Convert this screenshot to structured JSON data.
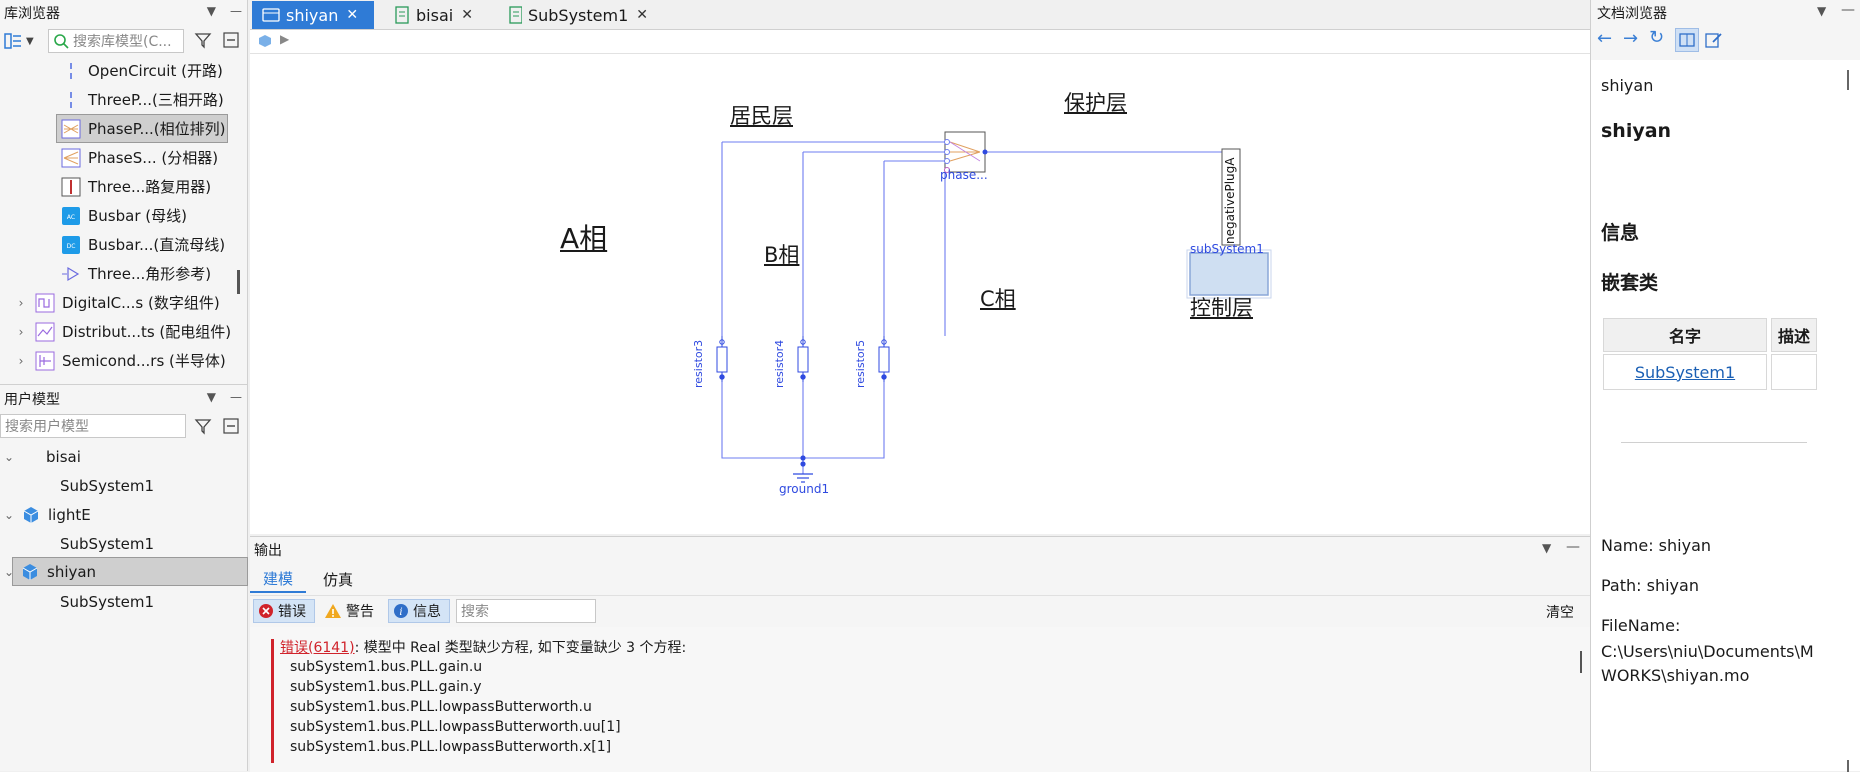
{
  "left": {
    "lib_title": "库浏览器",
    "lib_search_placeholder": "搜索库模型(C...",
    "lib_items": [
      {
        "label": "OpenCircuit (开路)",
        "icon": "open-circuit-icon"
      },
      {
        "label": "ThreeP...(三相开路)",
        "icon": "three-phase-open-icon"
      },
      {
        "label": "PhaseP...(相位排列)",
        "icon": "phase-permute-icon",
        "selected": true
      },
      {
        "label": "PhaseS... (分相器)",
        "icon": "phase-splitter-icon"
      },
      {
        "label": "Three...路复用器)",
        "icon": "multiplexer-icon"
      },
      {
        "label": "Busbar (母线)",
        "icon": "busbar-ac-icon"
      },
      {
        "label": "Busbar...(直流母线)",
        "icon": "busbar-dc-icon"
      },
      {
        "label": "Three...角形参考)",
        "icon": "delta-reference-icon"
      }
    ],
    "lib_groups": [
      {
        "label": "DigitalC...s (数字组件)",
        "icon": "digital-icon"
      },
      {
        "label": "Distribut...ts (配电组件)",
        "icon": "distribution-icon"
      },
      {
        "label": "Semicond...rs (半导体)",
        "icon": "semiconductor-icon"
      }
    ],
    "user_title": "用户模型",
    "user_search_placeholder": "搜索用户模型",
    "user_tree": [
      {
        "label": "bisai",
        "child": "SubSystem1"
      },
      {
        "label": "lightE",
        "child": "SubSystem1"
      },
      {
        "label": "shiyan",
        "child": "SubSystem1",
        "selected": true
      }
    ]
  },
  "tabs": [
    {
      "label": "shiyan",
      "active": true
    },
    {
      "label": "bisai",
      "active": false
    },
    {
      "label": "SubSystem1",
      "active": false
    }
  ],
  "diagram": {
    "labels": {
      "a_phase": "A相",
      "b_phase": "B相",
      "c_phase": "C相",
      "resident_layer": "居民层",
      "protection_layer": "保护层",
      "control_layer": "控制层"
    },
    "components": {
      "phase": "phase...",
      "resistor3": "resistor3",
      "resistor4": "resistor4",
      "resistor5": "resistor5",
      "ground": "ground1",
      "subsystem": "subSystem1",
      "negplug": "negativePlugA"
    }
  },
  "output": {
    "title": "输出",
    "tabs": [
      "建模",
      "仿真"
    ],
    "filters": {
      "error": "错误",
      "warning": "警告",
      "info": "信息"
    },
    "search_placeholder": "搜索",
    "clear": "清空",
    "error_code": "错误(6141)",
    "error_msg": ": 模型中 Real 类型缺少方程, 如下变量缺少 3 个方程:",
    "lines": [
      "subSystem1.bus.PLL.gain.u",
      "subSystem1.bus.PLL.gain.y",
      "subSystem1.bus.PLL.lowpassButterworth.u",
      "subSystem1.bus.PLL.lowpassButterworth.uu[1]",
      "subSystem1.bus.PLL.lowpassButterworth.x[1]"
    ]
  },
  "right": {
    "title": "文档浏览器",
    "crumb": "shiyan",
    "heading": "shiyan",
    "info": "信息",
    "nested": "嵌套类",
    "table_headers": [
      "名字",
      "描述"
    ],
    "table_row": "SubSystem1",
    "name_line": "Name: shiyan",
    "path_line": "Path: shiyan",
    "file_label": "FileName:",
    "file_path": "C:\\Users\\niu\\Documents\\MWORKS\\shiyan.mo"
  },
  "colors": {
    "accent": "#2f7bd6",
    "wire": "#4a5ae8",
    "error": "#d0232b"
  }
}
